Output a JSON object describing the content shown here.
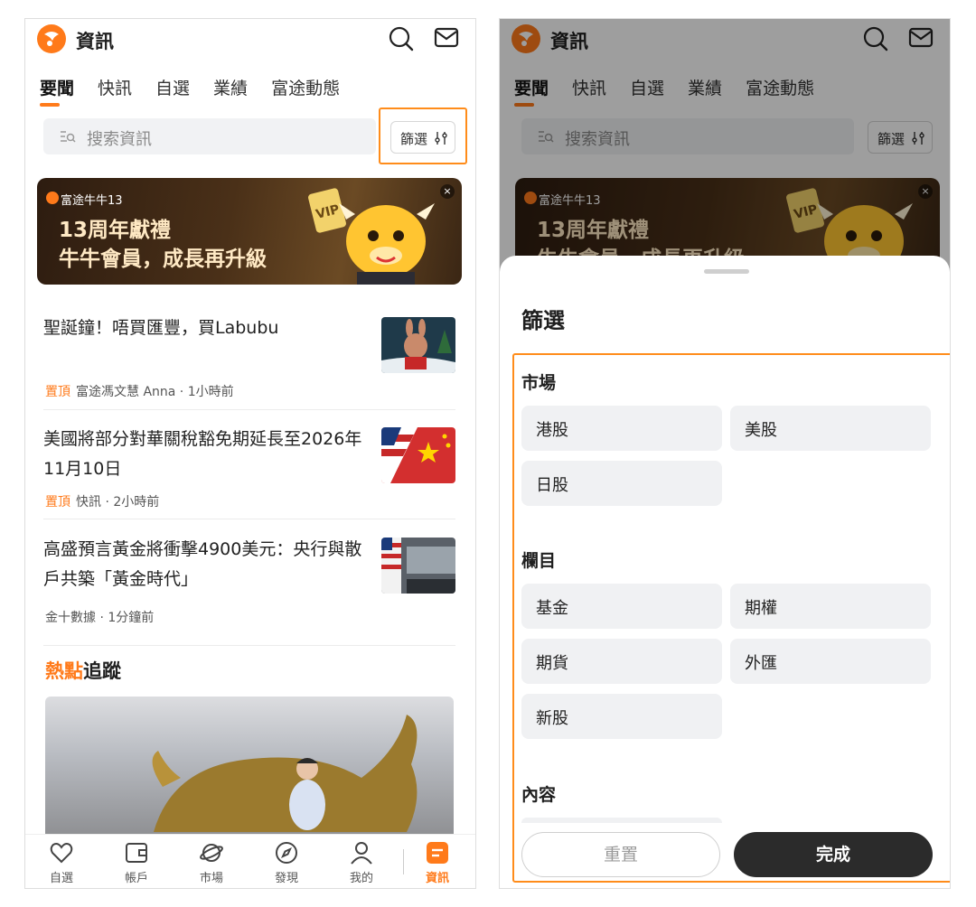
{
  "header": {
    "title": "資訊"
  },
  "tabs": [
    {
      "label": "要聞",
      "active": true
    },
    {
      "label": "快訊"
    },
    {
      "label": "自選"
    },
    {
      "label": "業績"
    },
    {
      "label": "富途動態"
    }
  ],
  "search": {
    "placeholder": "搜索資訊"
  },
  "filter_button": {
    "label": "篩選"
  },
  "banner": {
    "brand": "富途牛牛13",
    "line1": "13周年獻禮",
    "line2": "牛牛會員，成長再升級",
    "badge": "VIP",
    "close": "×"
  },
  "articles": [
    {
      "title": "聖誕鐘！唔買匯豐，買Labubu",
      "pin": "置頂",
      "meta": "富途馮文慧 Anna · 1小時前"
    },
    {
      "title": "美國將部分對華關稅豁免期延長至2026年11月10日",
      "pin": "置頂",
      "meta": "快訊 · 2小時前"
    },
    {
      "title": "高盛預言黃金將衝擊4900美元：央行與散戶共築「黃金時代」",
      "pin": "",
      "meta": "金十數據 · 1分鐘前"
    }
  ],
  "hot": {
    "accent": "熱點",
    "rest": "追蹤"
  },
  "bottom_nav": [
    {
      "label": "自選",
      "icon": "heart-icon"
    },
    {
      "label": "帳戶",
      "icon": "wallet-icon"
    },
    {
      "label": "市場",
      "icon": "planet-icon"
    },
    {
      "label": "發現",
      "icon": "compass-icon"
    },
    {
      "label": "我的",
      "icon": "person-icon"
    },
    {
      "label": "資訊",
      "icon": "news-icon",
      "active": true
    }
  ],
  "filter_sheet": {
    "title": "篩選",
    "sections": [
      {
        "title": "市場",
        "options": [
          "港股",
          "美股",
          "日股"
        ]
      },
      {
        "title": "欄目",
        "options": [
          "基金",
          "期權",
          "期貨",
          "外匯",
          "新股"
        ]
      },
      {
        "title": "內容",
        "options": []
      }
    ],
    "reset_label": "重置",
    "done_label": "完成"
  },
  "colors": {
    "accent": "#ff7a1a",
    "highlight_box": "#ff8c1a",
    "dark_button": "#2b2b2b"
  }
}
